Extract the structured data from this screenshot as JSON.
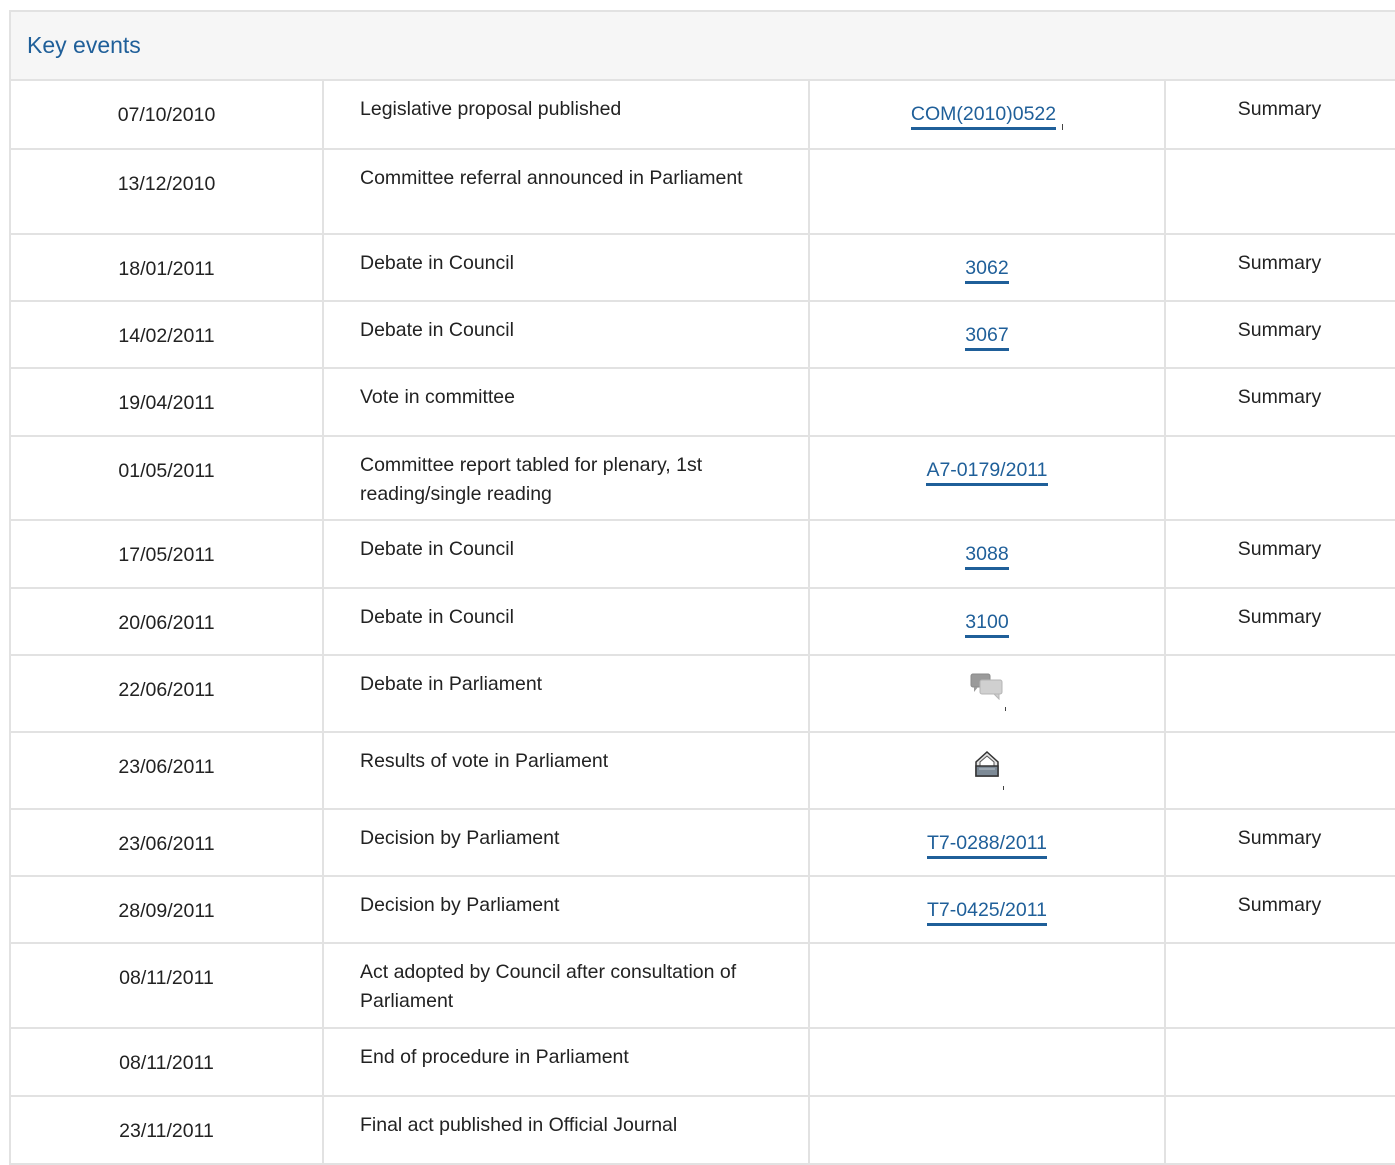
{
  "section": {
    "title": "Key events"
  },
  "events": [
    {
      "date": "07/10/2010",
      "event": "Legislative proposal published",
      "doc": "COM(2010)0522",
      "summary": "Summary"
    },
    {
      "date": "13/12/2010",
      "event": "Committee referral announced in Parliament",
      "doc": "",
      "summary": ""
    },
    {
      "date": "18/01/2011",
      "event": "Debate in Council",
      "doc": "3062",
      "summary": "Summary"
    },
    {
      "date": "14/02/2011",
      "event": "Debate in Council",
      "doc": "3067",
      "summary": "Summary"
    },
    {
      "date": "19/04/2011",
      "event": "Vote in committee",
      "doc": "",
      "summary": "Summary"
    },
    {
      "date": "01/05/2011",
      "event": "Committee report tabled for plenary, 1st reading/single reading",
      "doc": "A7-0179/2011",
      "summary": ""
    },
    {
      "date": "17/05/2011",
      "event": "Debate in Council",
      "doc": "3088",
      "summary": "Summary"
    },
    {
      "date": "20/06/2011",
      "event": "Debate in Council",
      "doc": "3100",
      "summary": "Summary"
    },
    {
      "date": "22/06/2011",
      "event": "Debate in Parliament",
      "doc_icon": "debate-speech-bubbles-icon",
      "summary": ""
    },
    {
      "date": "23/06/2011",
      "event": "Results of vote in Parliament",
      "doc_icon": "ballot-box-icon",
      "summary": ""
    },
    {
      "date": "23/06/2011",
      "event": "Decision by Parliament",
      "doc": "T7-0288/2011",
      "summary": "Summary"
    },
    {
      "date": "28/09/2011",
      "event": "Decision by Parliament",
      "doc": "T7-0425/2011",
      "summary": "Summary"
    },
    {
      "date": "08/11/2011",
      "event": "Act adopted by Council after consultation of Parliament",
      "doc": "",
      "summary": ""
    },
    {
      "date": "08/11/2011",
      "event": "End of procedure in Parliament",
      "doc": "",
      "summary": ""
    },
    {
      "date": "23/11/2011",
      "event": "Final act published in Official Journal",
      "doc": "",
      "summary": ""
    }
  ]
}
